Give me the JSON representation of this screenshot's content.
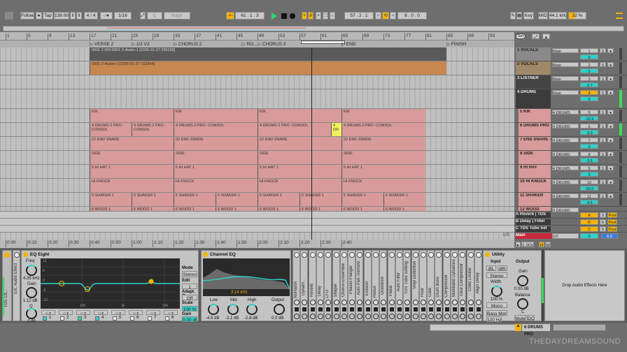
{
  "toolbar": {
    "follow": "Follow",
    "tap": "Tap",
    "tempo": "138.00",
    "time_sig": "4 / 4",
    "metronome": "○●",
    "quantize": "1/16",
    "key": "C",
    "scale": "Major",
    "position": "61 .  1 .  3",
    "loop_start": "57 .  2 .  1",
    "loop_length": "8 .  0 .  0",
    "key_btn": "Key",
    "midi_btn": "MIDI",
    "sample_rate": "44.1 kHz",
    "cpu": "32 %"
  },
  "colors": {
    "accent": "#f5b400",
    "cyan": "#2fd1c8",
    "drum_clip": "#d89a9a",
    "vocal_clip": "#c8874e",
    "main": "#c8283c"
  },
  "ruler": {
    "bars": [
      "1",
      "5",
      "9",
      "13",
      "17",
      "21",
      "25",
      "29",
      "33",
      "37",
      "41",
      "45",
      "49",
      "53",
      "57",
      "61",
      "65",
      "69",
      "73",
      "77",
      "81",
      "85",
      "89",
      "93"
    ]
  },
  "time_ruler": [
    "0:00",
    "0:10",
    "0:20",
    "0:30",
    "0:40",
    "0:50",
    "1:00",
    "1:10",
    "1:20",
    "1:30",
    "1:40",
    "1:50",
    "2:00",
    "2:10",
    "2:20",
    "2:30",
    "2:40"
  ],
  "locators": [
    {
      "label": "VERSE 2",
      "bar": 17
    },
    {
      "label": "1/2 V2",
      "bar": 25
    },
    {
      "label": "CHORUS 2",
      "bar": 33
    },
    {
      "label": "RO...",
      "bar": 46
    },
    {
      "label": "CHORUS 3",
      "bar": 49
    },
    {
      "label": "END",
      "bar": 65
    },
    {
      "label": "FINISH",
      "bar": 85
    }
  ],
  "tracks": [
    {
      "name": "1 VOCALS",
      "route": "Main",
      "num": "1",
      "vol": "0",
      "color": "#8a8a8a",
      "clips": [
        {
          "label": "0001 2 000 0001 2-Audio-1 [2026-01-27 095156]",
          "from": 17,
          "to": 85,
          "color": "#5a5a5a"
        }
      ]
    },
    {
      "name": "2 VOCALS",
      "route": "Main",
      "num": "2",
      "vol": "0",
      "color": "#a08868",
      "clips": [
        {
          "label": "0001 2-Audio-1 [2026-01-27 192844]",
          "from": 17,
          "to": 85,
          "color": "#c8874e"
        }
      ]
    },
    {
      "name": "3 LISTNER",
      "route": "Main",
      "num": "3",
      "vol": "-2.7",
      "color": "#444444",
      "clips": []
    },
    {
      "name": "4 DRUMS",
      "route": "Main",
      "num": "4",
      "vol": "0",
      "color": "#3c3c3c",
      "clips": []
    },
    {
      "name": "5 KIK",
      "route": "4 DRUMS",
      "num": "5",
      "vol": "-10.9",
      "color": "#d89a9a",
      "clips": [
        {
          "label": "KIK",
          "from": 17,
          "to": 33
        },
        {
          "label": "KIK",
          "from": 33,
          "to": 49
        },
        {
          "label": "KIK",
          "from": 49,
          "to": 65
        },
        {
          "label": "KIK",
          "from": 65,
          "to": 81
        }
      ]
    },
    {
      "name": "6 DRUMS PRO",
      "route": "4 DRUMS",
      "num": "6",
      "vol": "-3.9",
      "color": "#d89a9a",
      "clips": [
        {
          "label": "4 DRUMS 2 PRO -CONSOL",
          "from": 17,
          "to": 25
        },
        {
          "label": "4 DRUMS 2 PRO -CONSOL",
          "from": 25,
          "to": 33
        },
        {
          "label": "4 DRUMS 2 PRO -CONSOL",
          "from": 33,
          "to": 49
        },
        {
          "label": "4 DRUMS 2 PRO -CONSOL",
          "from": 49,
          "to": 63
        },
        {
          "label": "4 DR",
          "from": 63,
          "to": 65,
          "color": "#f0f060"
        },
        {
          "label": "4 DRUMS 2 PRO -CONSOL",
          "from": 65,
          "to": 81
        }
      ]
    },
    {
      "name": "7 END SNARE -",
      "route": "4 DRUMS",
      "num": "7",
      "vol": "0",
      "color": "#d89a9a",
      "clips": [
        {
          "label": "22 END SNARE",
          "from": 17,
          "to": 33
        },
        {
          "label": "22 END SNARE",
          "from": 33,
          "to": 49
        },
        {
          "label": "22 END SNARE",
          "from": 49,
          "to": 65
        },
        {
          "label": "22 END SNARE",
          "from": 65,
          "to": 81
        }
      ]
    },
    {
      "name": "8 SIDE",
      "route": "4 DRUMS",
      "num": "8",
      "vol": "-3.6",
      "color": "#d89a9a",
      "clips": [
        {
          "label": "SIDE",
          "from": 17,
          "to": 33
        },
        {
          "label": "SIDE",
          "from": 33,
          "to": 49
        },
        {
          "label": "SIDE",
          "from": 49,
          "to": 65
        },
        {
          "label": "SIDE",
          "from": 65,
          "to": 81
        }
      ]
    },
    {
      "name": "9 HI HAT",
      "route": "4 DRUMS",
      "num": "9",
      "vol": "0",
      "color": "#d89a9a",
      "clips": [
        {
          "label": "5 HI HAT 1",
          "from": 17,
          "to": 33
        },
        {
          "label": "5 HI HAT 1",
          "from": 33,
          "to": 49
        },
        {
          "label": "5 HI HAT 1",
          "from": 49,
          "to": 65
        },
        {
          "label": "5 HI HAT 1",
          "from": 65,
          "to": 81
        }
      ]
    },
    {
      "name": "10 HI KNOCK",
      "route": "4 DRUMS",
      "num": "10",
      "vol": "-10.0",
      "color": "#d89a9a",
      "clips": [
        {
          "label": "HI KNOCK",
          "from": 17,
          "to": 33
        },
        {
          "label": "HI KNOCK",
          "from": 33,
          "to": 49
        },
        {
          "label": "HI KNOCK",
          "from": 49,
          "to": 65
        },
        {
          "label": "HI KNOCK",
          "from": 65,
          "to": 81
        }
      ]
    },
    {
      "name": "11 SHAKER",
      "route": "4 DRUMS",
      "num": "11",
      "vol": "-4.5",
      "color": "#d89a9a",
      "clips": [
        {
          "label": "5 SHAKER 1",
          "from": 17,
          "to": 25
        },
        {
          "label": "5 SHAKER 1",
          "from": 25,
          "to": 33
        },
        {
          "label": "5 SHAKER 1",
          "from": 33,
          "to": 41
        },
        {
          "label": "5 SHAKER 1",
          "from": 41,
          "to": 49
        },
        {
          "label": "5 SHAKER 1",
          "from": 49,
          "to": 57
        },
        {
          "label": "5 SHAKER 1",
          "from": 57,
          "to": 65
        },
        {
          "label": "5 SHAKER 1",
          "from": 65,
          "to": 73
        },
        {
          "label": "5 SHAKER 1",
          "from": 73,
          "to": 81
        }
      ]
    },
    {
      "name": "12 WOOD",
      "route": "4 DRUMS",
      "num": "12",
      "vol": "",
      "color": "#d89a9a",
      "clips": [
        {
          "label": "6 WOOD 1",
          "from": 17,
          "to": 25
        },
        {
          "label": "6 WOOD 1",
          "from": 25,
          "to": 33
        },
        {
          "label": "6 WOOD 1",
          "from": 33,
          "to": 41
        },
        {
          "label": "6 WOOD 1",
          "from": 41,
          "to": 49
        },
        {
          "label": "6 WOOD 1",
          "from": 49,
          "to": 57
        },
        {
          "label": "6 WOOD 1",
          "from": 57,
          "to": 65
        },
        {
          "label": "6 WOOD 1",
          "from": 65,
          "to": 73
        },
        {
          "label": "6 WOOD 1",
          "from": 73,
          "to": 81
        }
      ]
    }
  ],
  "returns": [
    {
      "name": "A Reverb | TDS",
      "letter": "A",
      "post": "Post"
    },
    {
      "name": "B Delay | Filter",
      "letter": "B",
      "post": "Post"
    },
    {
      "name": "C TDS Tube Set",
      "letter": "C",
      "post": "Post"
    }
  ],
  "main": {
    "name": "Main",
    "route": "1/2",
    "vol": "0",
    "pan": "6.0"
  },
  "mixer_labels": {
    "set": "Set",
    "solo": "S",
    "zoom": "1.00x",
    "h": "H",
    "w": "W",
    "quant": "1/8"
  },
  "rack": {
    "name": "TDS Ch...",
    "ext": "Ext. Audio Effect"
  },
  "eq8": {
    "title": "EQ Eight",
    "freq_label": "Freq",
    "freq": "4.35 kHz",
    "gain_label": "Gain",
    "gain": "1.12 dB",
    "q_label": "Q",
    "q": "2.49",
    "db_ticks": [
      "12",
      "6",
      "0",
      "-6",
      "-12"
    ],
    "freq_ticks": [
      "100",
      "1k",
      "10k"
    ],
    "bands": [
      "1",
      "2",
      "3",
      "4",
      "5",
      "6",
      "7",
      "8"
    ],
    "bands_on": [
      true,
      false,
      true,
      true,
      false,
      false,
      false,
      false
    ],
    "mode_label": "Mode",
    "mode": "Stereo",
    "edit_label": "Edit",
    "edit": "1",
    "adapt_label": "Adapt. Q",
    "adapt": "Off",
    "scale_label": "Scale",
    "scale": "100 %",
    "out_gain_label": "Gain",
    "out_gain": "0.00 dB"
  },
  "ceq": {
    "title": "Channel EQ",
    "freq": "3.14 kHz",
    "ticks": [
      "12",
      "0",
      "-12",
      "100",
      "1k",
      "10k"
    ],
    "low_label": "Low",
    "low": "-4.5 dB",
    "mid_label": "Mid",
    "mid": "-3.1 dB",
    "high_label": "High",
    "high": "-2.8 dB",
    "out_label": "Output",
    "out": "0.0 dB"
  },
  "effects": [
    "NoHarsh",
    "Dynam...",
    "Reverb",
    "Delay",
    "LFO",
    "Shaper",
    "Chorus-Ensemble",
    "Phaser-Flanger",
    "Auto Pan-Tremolo",
    "Erosion",
    "Redux",
    "Overdrive",
    "Pedal",
    "Auto Filter",
    "TDS Tube Setting",
    "Vinyl Distortion",
    "Roar",
    "Gate",
    "Drum Buss",
    "Compressor",
    "Multiband Dynamics",
    "Glue Compressor",
    "Color Limiter",
    "Align Delay"
  ],
  "utility": {
    "title": "Utility",
    "input": "Input",
    "output": "Output",
    "l": "ØL",
    "r": "ØR",
    "mode": "Stereo",
    "width_label": "Width",
    "width": "100 %",
    "mono": "Mono",
    "bass_mono": "Bass Mono",
    "bass_freq": "120 Hz",
    "gain_label": "Gain",
    "gain": "0.00 dB",
    "balance_label": "Balance",
    "balance": "C",
    "mute": "Mute",
    "dc": "DC"
  },
  "drop_text": "Drop Audio Effects Here",
  "status": {
    "selected_track": "6 DRUMS PRO"
  },
  "watermark": "THEDAYDREAMSOUND"
}
